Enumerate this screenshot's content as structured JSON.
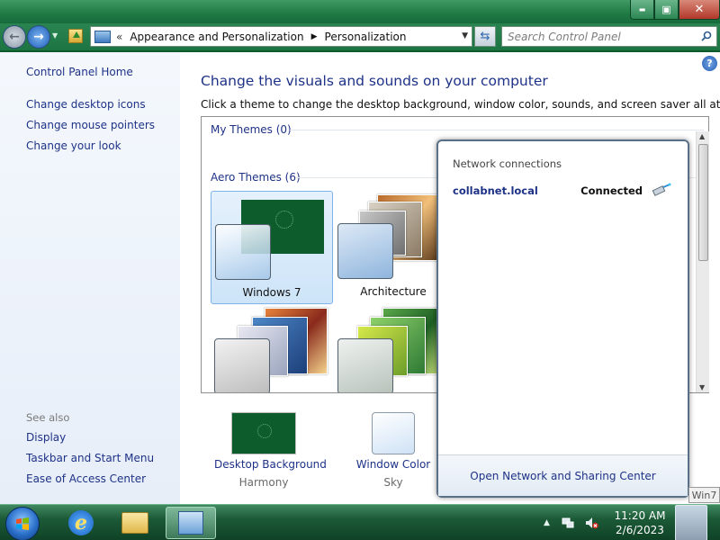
{
  "window": {
    "minimize_glyph": "▬",
    "maximize_glyph": "▣",
    "close_glyph": "✕"
  },
  "navbar": {
    "back_glyph": "←",
    "forward_glyph": "→",
    "breadcrumb_chevron": "«",
    "breadcrumbs": [
      "Appearance and Personalization",
      "Personalization"
    ],
    "crumb_separator": "▶",
    "search_placeholder": "Search Control Panel"
  },
  "sidebar": {
    "home": "Control Panel Home",
    "links": [
      "Change desktop icons",
      "Change mouse pointers",
      "Change your look"
    ],
    "see_also_label": "See also",
    "see_also": [
      "Display",
      "Taskbar and Start Menu",
      "Ease of Access Center"
    ]
  },
  "main": {
    "help_glyph": "?",
    "title": "Change the visuals and sounds on your computer",
    "subtitle": "Click a theme to change the desktop background, window color, sounds, and screen saver all at once.",
    "groups": [
      {
        "label": "My Themes (0)"
      },
      {
        "label": "Aero Themes (6)"
      }
    ],
    "themes": [
      {
        "name": "Windows 7",
        "selected": true
      },
      {
        "name": "Architecture",
        "selected": false
      },
      {
        "name": "",
        "selected": false
      },
      {
        "name": "",
        "selected": false
      }
    ],
    "bottom": [
      {
        "label": "Desktop Background",
        "value": "Harmony"
      },
      {
        "label": "Window Color",
        "value": "Sky"
      }
    ]
  },
  "network_flyout": {
    "heading": "Network connections",
    "network_name": "collabnet.local",
    "status": "Connected",
    "footer_link": "Open Network and Sharing Center"
  },
  "watermark": "Win7",
  "taskbar": {
    "apps": [
      {
        "icon": "internet-explorer-icon"
      },
      {
        "icon": "windows-explorer-icon"
      },
      {
        "icon": "control-panel-icon",
        "active": true
      }
    ],
    "tray_expand_glyph": "▲",
    "time": "11:20 AM",
    "date": "2/6/2023"
  },
  "colors": {
    "accent_link": "#1e3287",
    "window_frame": "#1f7a44",
    "taskbar": "#1c5a37"
  }
}
